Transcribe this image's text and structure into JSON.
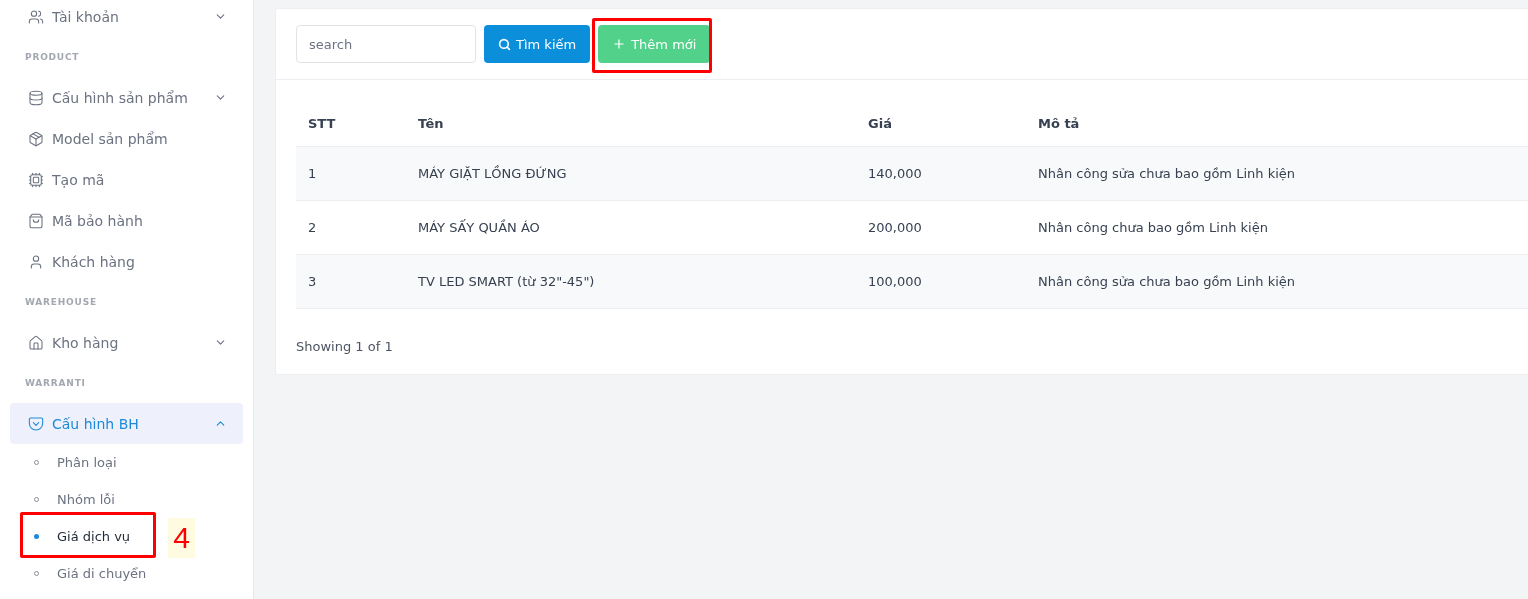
{
  "sidebar": {
    "sections": [
      {
        "items": [
          {
            "label": "Tài khoản",
            "expanded": false,
            "selected": false
          }
        ]
      },
      {
        "heading": "PRODUCT",
        "items": [
          {
            "label": "Cấu hình sản phẩm",
            "expanded": false,
            "selected": false
          },
          {
            "label": "Model sản phẩm",
            "selected": false
          },
          {
            "label": "Tạo mã",
            "selected": false
          },
          {
            "label": "Mã bảo hành",
            "selected": false
          },
          {
            "label": "Khách hàng",
            "selected": false
          }
        ]
      },
      {
        "heading": "WAREHOUSE",
        "items": [
          {
            "label": "Kho hàng",
            "expanded": false,
            "selected": false
          }
        ]
      },
      {
        "heading": "WARRANTI",
        "items": [
          {
            "label": "Cấu hình BH",
            "expanded": true,
            "selected": true,
            "children": [
              {
                "label": "Phân loại",
                "selected": false,
                "highlighted": false
              },
              {
                "label": "Nhóm lỗi",
                "selected": false,
                "highlighted": false
              },
              {
                "label": "Giá dịch vụ",
                "selected": true,
                "highlighted": true,
                "step": "4"
              },
              {
                "label": "Giá di chuyển",
                "selected": false,
                "highlighted": false
              }
            ]
          }
        ]
      }
    ]
  },
  "toolbar": {
    "search": {
      "placeholder": "search"
    },
    "search_button": {
      "label": "Tìm kiếm"
    },
    "add_button": {
      "label": "Thêm mới",
      "highlighted": true
    }
  },
  "table": {
    "columns": [
      "STT",
      "Tên",
      "Giá",
      "Mô tả"
    ],
    "rows": [
      [
        "1",
        "MÁY GIẶT LỒNG ĐỨNG",
        "140,000",
        "Nhân công sửa chưa bao gồm Linh kiện"
      ],
      [
        "2",
        "MÁY SẤY QUẦN ÁO",
        "200,000",
        "Nhân công chưa bao gồm Linh kiện"
      ],
      [
        "3",
        "TV LED SMART (từ 32\"-45\")",
        "100,000",
        "Nhân công sửa chưa bao gồm Linh kiện"
      ]
    ]
  },
  "footer": {
    "text": "Showing 1 of 1"
  }
}
